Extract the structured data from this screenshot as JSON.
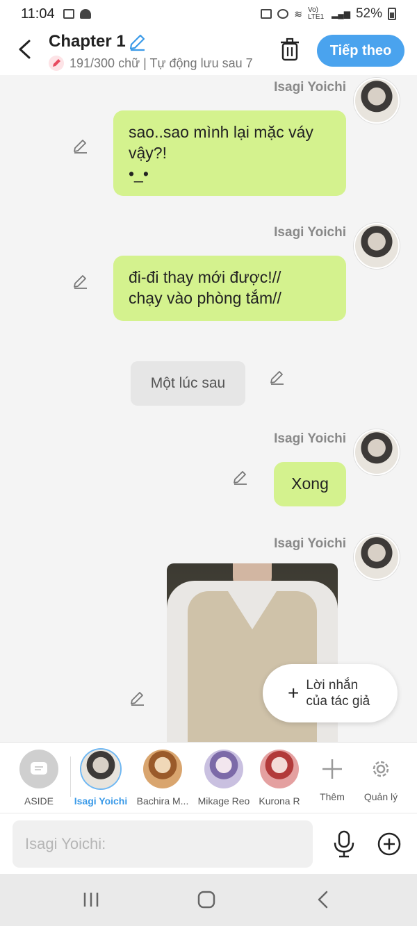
{
  "status": {
    "time": "11:04",
    "battery": "52%",
    "network": "Vo) LTE1"
  },
  "header": {
    "title": "Chapter 1",
    "meta": "191/300 chữ | Tự động lưu sau 7",
    "next_label": "Tiếp theo"
  },
  "messages": [
    {
      "sender": "Isagi Yoichi",
      "lines": [
        "sao..sao mình lại mặc váy",
        "vậy?!",
        "•_•"
      ]
    },
    {
      "sender": "Isagi Yoichi",
      "lines": [
        "đi-đi thay mới được!//",
        "chạy vào phòng tắm//"
      ]
    },
    {
      "aside": "Một lúc sau"
    },
    {
      "sender": "Isagi Yoichi",
      "lines": [
        "Xong"
      ]
    },
    {
      "sender": "Isagi Yoichi",
      "type": "image"
    }
  ],
  "float_note": {
    "line1": "Lời nhắn",
    "line2": "của tác giả"
  },
  "characters": [
    {
      "label": "ASIDE"
    },
    {
      "label": "Isagi Yoichi"
    },
    {
      "label": "Bachira M..."
    },
    {
      "label": "Mikage Reo"
    },
    {
      "label": "Kurona R"
    },
    {
      "label": "Thêm"
    },
    {
      "label": "Quản lý"
    }
  ],
  "input": {
    "placeholder": "Isagi Yoichi:"
  },
  "colors": {
    "accent": "#4aa3ee",
    "bubble": "#d4f28e",
    "aside": "#e6e6e6"
  }
}
